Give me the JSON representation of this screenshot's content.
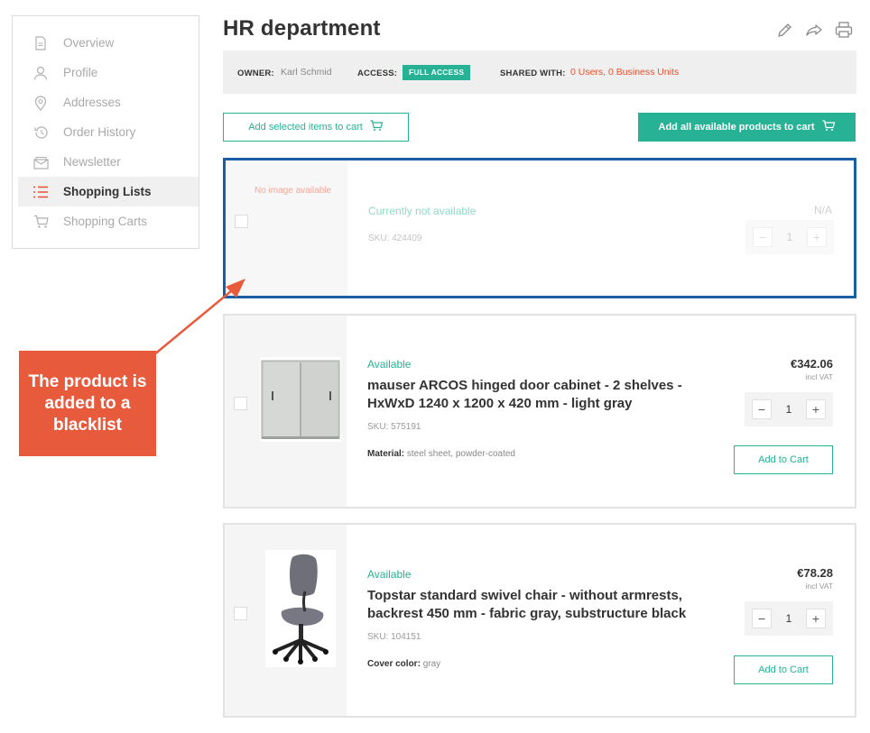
{
  "sidebar": {
    "items": [
      {
        "label": "Overview",
        "icon": "document-icon",
        "active": false
      },
      {
        "label": "Profile",
        "icon": "user-icon",
        "active": false
      },
      {
        "label": "Addresses",
        "icon": "location-pin-icon",
        "active": false
      },
      {
        "label": "Order History",
        "icon": "history-icon",
        "active": false
      },
      {
        "label": "Newsletter",
        "icon": "envelope-icon",
        "active": false
      },
      {
        "label": "Shopping Lists",
        "icon": "list-icon",
        "active": true
      },
      {
        "label": "Shopping Carts",
        "icon": "cart-icon",
        "active": false
      }
    ]
  },
  "header": {
    "title": "HR department",
    "icons": [
      "edit-icon",
      "share-icon",
      "print-icon"
    ]
  },
  "info": {
    "owner_label": "OWNER:",
    "owner_value": "Karl Schmid",
    "access_label": "ACCESS:",
    "access_value": "FULL ACCESS",
    "shared_label": "SHARED WITH:",
    "shared_value": "0 Users, 0 Business Units"
  },
  "actions": {
    "add_selected": "Add selected items to cart",
    "add_all": "Add all available products to cart"
  },
  "products": [
    {
      "no_image": "No image available",
      "status": "Currently not available",
      "sku": "SKU: 424409",
      "price": "N/A",
      "qty": "1"
    },
    {
      "status": "Available",
      "name": "mauser ARCOS hinged door cabinet - 2 shelves - HxWxD 1240 x 1200 x 420 mm - light gray",
      "sku": "SKU: 575191",
      "attr_label": "Material:",
      "attr_value": "steel sheet, powder-coated",
      "price": "€342.06",
      "vat": "incl VAT",
      "qty": "1",
      "add_label": "Add to Cart"
    },
    {
      "status": "Available",
      "name": "Topstar standard swivel chair - without armrests, backrest 450 mm - fabric gray, substructure black",
      "sku": "SKU: 104151",
      "attr_label": "Cover color:",
      "attr_value": "gray",
      "price": "€78.28",
      "vat": "incl VAT",
      "qty": "1",
      "add_label": "Add to Cart"
    }
  ],
  "stepper": {
    "minus": "−",
    "plus": "+"
  },
  "annotation": {
    "text": "The product is added to a blacklist"
  },
  "colors": {
    "accent": "#27b295",
    "highlight_border": "#1a5fa6",
    "callout": "#e85a3c",
    "shared": "#e4522f"
  }
}
